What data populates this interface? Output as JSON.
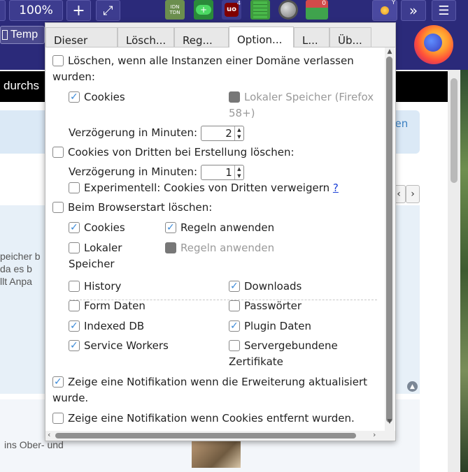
{
  "toolbar": {
    "zoom": "100%",
    "plus": "+",
    "fullscreen": "⤢",
    "more": "»",
    "menu": "☰",
    "ext_idn": "IDN\nTDN",
    "ext_ublock_badge": "4",
    "ext_meter_badge": "0",
    "ext_cookie_badge": "Y"
  },
  "bookmarks": {
    "temp_label": "Temp"
  },
  "page": {
    "black_bar_text": "durchs",
    "link_den": "den",
    "bg_line1": "peicher b",
    "bg_line2": "da es b",
    "bg_line3": "llt Anpa",
    "bg_bottom": "ins Ober- und",
    "pager_prev": "‹",
    "pager_next": "›"
  },
  "popup": {
    "tabs": [
      {
        "label": "Dieser"
      },
      {
        "label": "Lösch..."
      },
      {
        "label": "Reg..."
      },
      {
        "label": "Option..."
      },
      {
        "label": "L..."
      },
      {
        "label": "Üb..."
      }
    ],
    "opt_domain_delete": "Löschen, wenn alle Instanzen einer Domäne verlassen wurden:",
    "opt_cookies": "Cookies",
    "opt_local_storage": "Lokaler Speicher (Firefox 58+)",
    "opt_delay_label": "Verzögerung in Minuten:",
    "delay1_value": "2",
    "opt_third_party": "Cookies von Dritten bei Erstellung löschen:",
    "opt_delay_label2": "Verzögerung in Minuten:",
    "delay2_value": "1",
    "opt_experimental": "Experimentell: Cookies von Dritten verweigern",
    "opt_help": "?",
    "opt_browser_start": "Beim Browserstart löschen:",
    "opt_start_cookies": "Cookies",
    "opt_apply_rules": "Regeln anwenden",
    "opt_start_local": "Lokaler Speicher",
    "opt_apply_rules2": "Regeln anwenden",
    "opt_history": "History",
    "opt_downloads": "Downloads",
    "opt_form_data": "Form Daten",
    "opt_passwords": "Passwörter",
    "opt_indexed_db": "Indexed DB",
    "opt_plugin_data": "Plugin Daten",
    "opt_service_workers": "Service Workers",
    "opt_server_certs": "Servergebundene Zertifikate",
    "opt_notify_update": "Zeige eine Notifikation wenn die Erweiterung aktualisiert wurde.",
    "opt_notify_removed": "Zeige eine Notifikation wenn Cookies entfernt wurden."
  },
  "colors": {
    "toolbar_bg": "#2b2a7a",
    "check_blue": "#3c8ad8"
  }
}
